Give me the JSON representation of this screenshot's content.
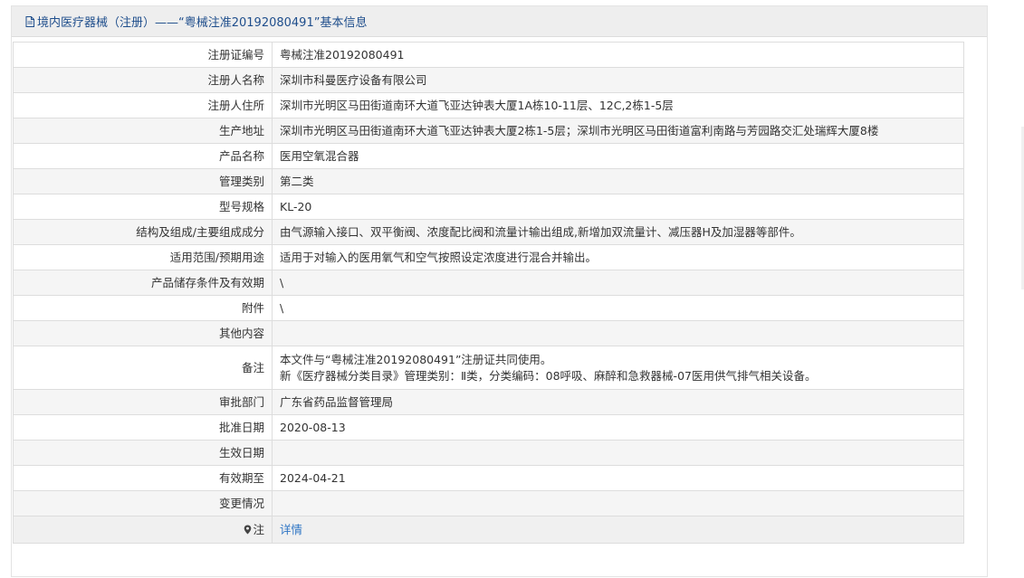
{
  "header": {
    "title": "境内医疗器械（注册）——“粤械注准20192080491”基本信息"
  },
  "rows": [
    {
      "label": "注册证编号",
      "value": "粤械注准20192080491"
    },
    {
      "label": "注册人名称",
      "value": "深圳市科曼医疗设备有限公司"
    },
    {
      "label": "注册人住所",
      "value": "深圳市光明区马田街道南环大道飞亚达钟表大厦1A栋10-11层、12C,2栋1-5层"
    },
    {
      "label": "生产地址",
      "value": "深圳市光明区马田街道南环大道飞亚达钟表大厦2栋1-5层；深圳市光明区马田街道富利南路与芳园路交汇处瑞辉大厦8楼"
    },
    {
      "label": "产品名称",
      "value": "医用空氧混合器"
    },
    {
      "label": "管理类别",
      "value": "第二类"
    },
    {
      "label": "型号规格",
      "value": "KL-20"
    },
    {
      "label": "结构及组成/主要组成成分",
      "value": "由气源输入接口、双平衡阀、浓度配比阀和流量计输出组成,新增加双流量计、减压器H及加湿器等部件。"
    },
    {
      "label": "适用范围/预期用途",
      "value": "适用于对输入的医用氧气和空气按照设定浓度进行混合并输出。"
    },
    {
      "label": "产品储存条件及有效期",
      "value": "\\"
    },
    {
      "label": "附件",
      "value": "\\"
    },
    {
      "label": "其他内容",
      "value": ""
    },
    {
      "label": "备注",
      "value": "本文件与“粤械注准20192080491”注册证共同使用。",
      "value2": "新《医疗器械分类目录》管理类别：Ⅱ类，分类编码：08呼吸、麻醉和急救器械-07医用供气排气相关设备。"
    },
    {
      "label": "审批部门",
      "value": "广东省药品监督管理局"
    },
    {
      "label": "批准日期",
      "value": "2020-08-13"
    },
    {
      "label": "生效日期",
      "value": ""
    },
    {
      "label": "有效期至",
      "value": "2024-04-21"
    },
    {
      "label": "变更情况",
      "value": ""
    },
    {
      "label": "注",
      "value": "详情"
    }
  ],
  "icons": {
    "header": "document-icon",
    "note": "map-pin-icon"
  },
  "colors": {
    "header_text": "#1f4e8c",
    "link": "#2d74c4"
  }
}
